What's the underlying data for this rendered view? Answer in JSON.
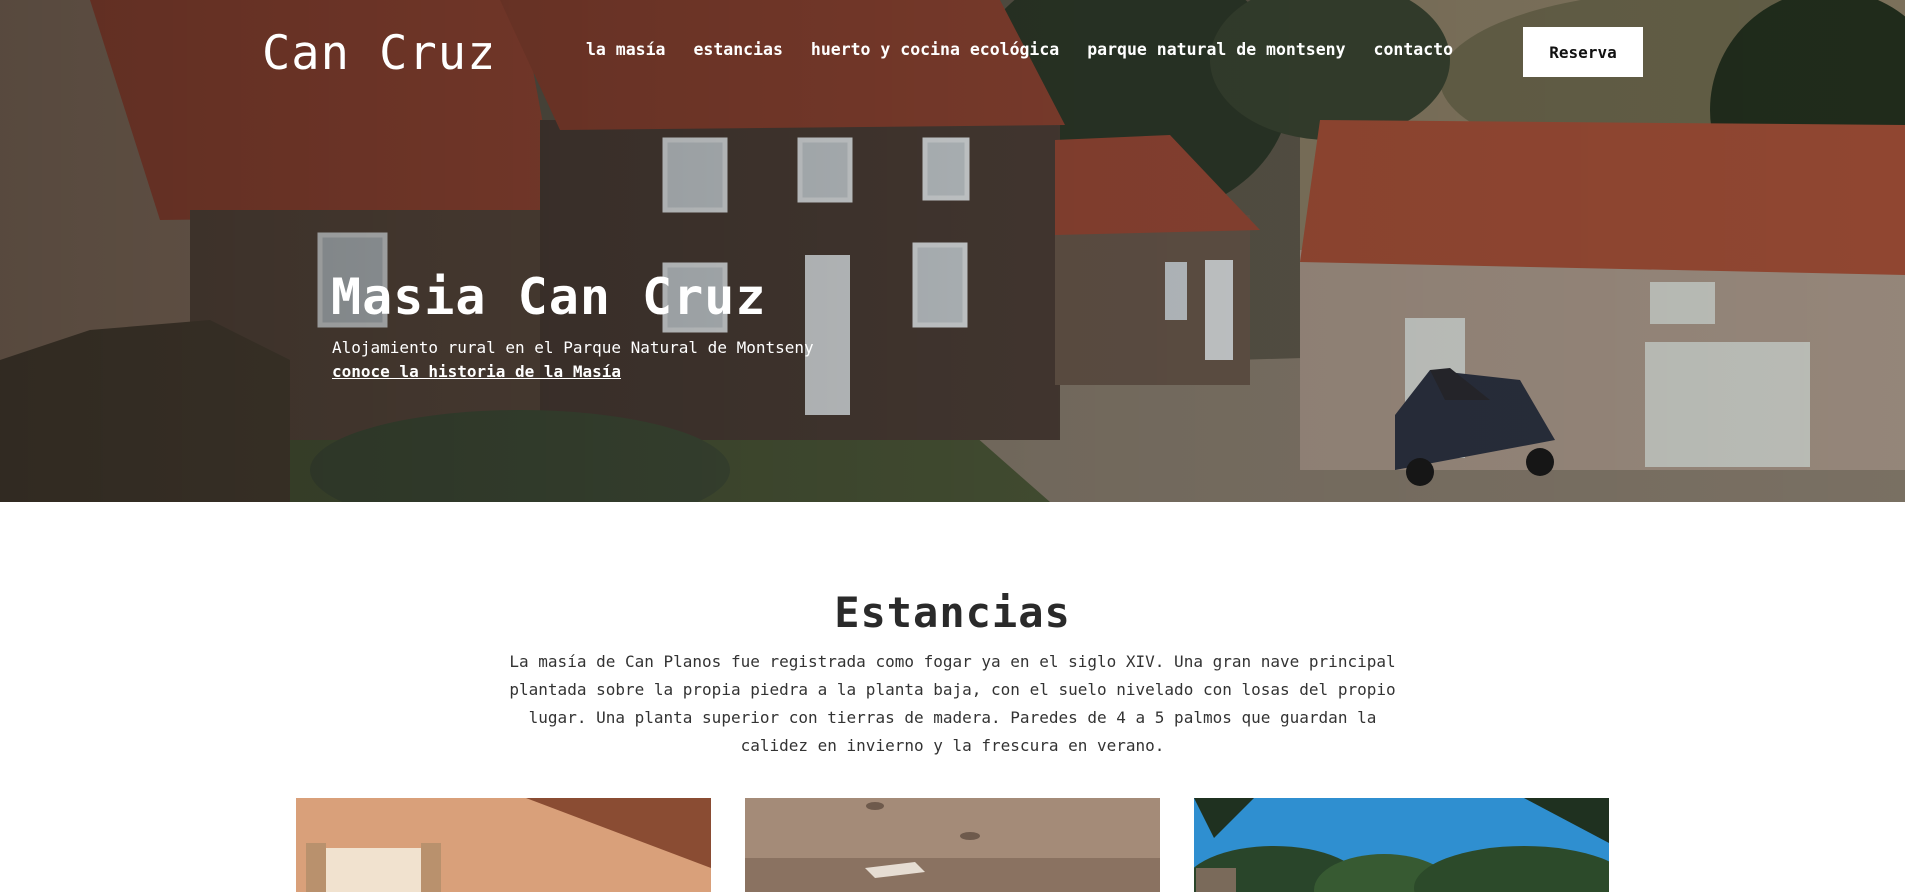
{
  "header": {
    "brand": "Can Cruz",
    "nav": [
      {
        "label": "la masía"
      },
      {
        "label": "estancias"
      },
      {
        "label": "huerto y cocina ecológica"
      },
      {
        "label": "parque natural de montseny"
      },
      {
        "label": "contacto"
      }
    ],
    "cta_label": "Reserva"
  },
  "hero": {
    "title": "Masia Can Cruz",
    "subtitle": "Alojamiento rural en el Parque Natural de Montseny",
    "link_label": "conoce la historia de la Masía"
  },
  "estancias": {
    "title": "Estancias",
    "description": "La masía de Can Planos fue registrada como fogar ya en el siglo XIV. Una gran nave principal plantada sobre la propia piedra a la planta baja, con el suelo nivelado con losas del propio lugar. Una planta superior con tierras de madera. Paredes de 4 a 5 palmos que guardan la calidez en invierno y la frescura en verano."
  },
  "colors": {
    "accent": "#ffffff",
    "text": "#2a2a2a",
    "roof": "#9a4a37",
    "stone": "#6d5e52"
  }
}
